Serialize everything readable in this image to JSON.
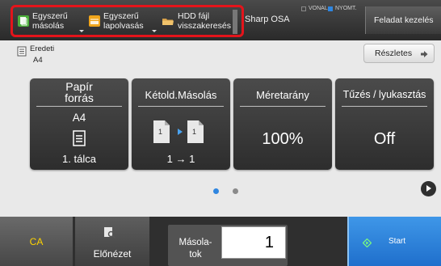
{
  "topbar": {
    "shortcuts": [
      {
        "label": "Egyszerű\nmásolás",
        "icon": "copy-icon",
        "color": "#4caf3a"
      },
      {
        "label": "Egyszerű\nlapolvasás",
        "icon": "scan-icon",
        "color": "#f0a51c"
      },
      {
        "label": "HDD fájl\nvisszakeresés",
        "icon": "folder-icon",
        "color": "#d9a24a"
      }
    ],
    "sharp_osa": "Sharp OSA",
    "status": {
      "line": "VONAL",
      "print": "NYOMT."
    },
    "task_button": "Feladat kezelés",
    "highlight_color": "#e4141b"
  },
  "original": {
    "label": "Eredeti",
    "value": "A4"
  },
  "details_button": "Részletes",
  "tiles": [
    {
      "title": "Papír\nforrás",
      "value": "A4",
      "sub": "1. tálca",
      "icon": "paper-tray-icon"
    },
    {
      "title": "Kétold.Másolás",
      "sub": "1 → 1",
      "icon": "duplex-copy-icon"
    },
    {
      "title": "Méretarány",
      "value": "100%"
    },
    {
      "title": "Tűzés / lyukasztás",
      "value": "Off"
    }
  ],
  "pagination": {
    "pages": 2,
    "current": 1,
    "active_color": "#2f86e0"
  },
  "bottom": {
    "ca_label": "CA",
    "preview_label": "Előnézet",
    "copies_label": "Másola-\ntok",
    "copies_value": "1",
    "start_label": "Start"
  },
  "colors": {
    "ca_text": "#ffd400",
    "start_bg": "#2a84dc"
  }
}
